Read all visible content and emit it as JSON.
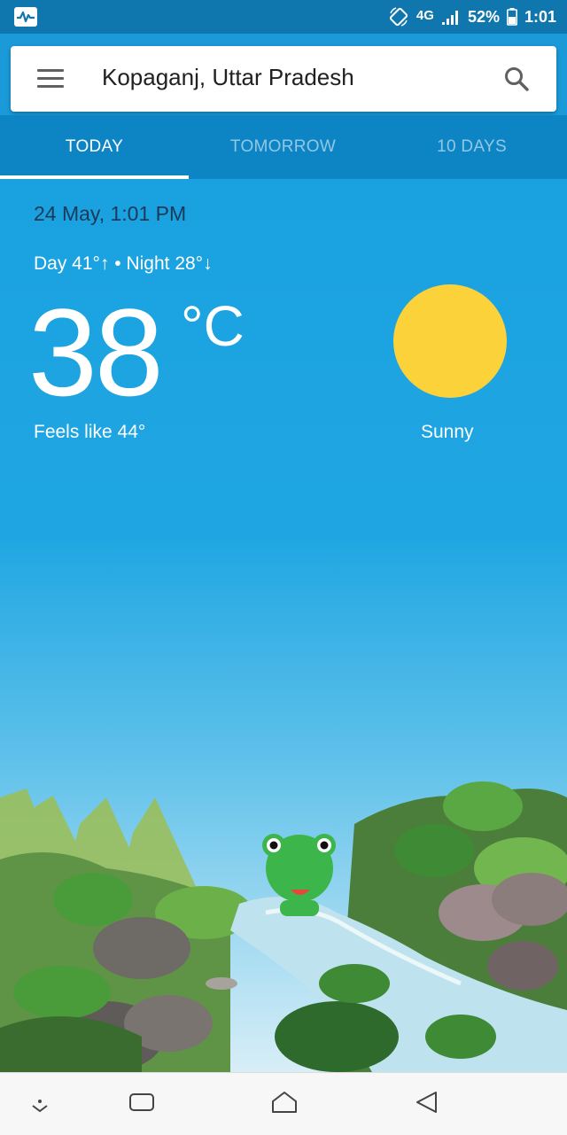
{
  "status_bar": {
    "network": "4G",
    "battery": "52%",
    "time": "1:01"
  },
  "search": {
    "location": "Kopaganj, Uttar Pradesh"
  },
  "tabs": [
    {
      "label": "TODAY",
      "active": true
    },
    {
      "label": "TOMORROW",
      "active": false
    },
    {
      "label": "10 DAYS",
      "active": false
    }
  ],
  "weather": {
    "datetime": "24 May, 1:01 PM",
    "day_night": "Day 41°↑ • Night 28°↓",
    "temperature": "38",
    "unit": "°C",
    "feels_like": "Feels like 44°",
    "condition": "Sunny",
    "condition_icon": "sun-icon"
  },
  "colors": {
    "status_bar": "#0f76ae",
    "tab_bar": "#0d84c4",
    "sky_top": "#1aa1e0",
    "sun": "#fcd23a"
  }
}
